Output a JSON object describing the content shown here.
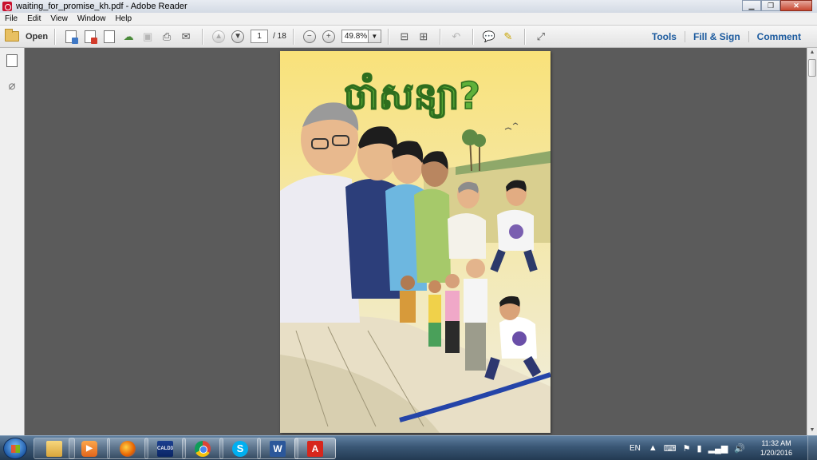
{
  "window": {
    "title": "waiting_for_promise_kh.pdf - Adobe Reader",
    "minimize": "▁",
    "restore": "❐",
    "close": "✕"
  },
  "menu": [
    "File",
    "Edit",
    "View",
    "Window",
    "Help"
  ],
  "toolbar": {
    "open_label": "Open",
    "page_current": "1",
    "page_total": "/ 18",
    "zoom_value": "49.8%",
    "zoom_dropdown": "▼",
    "tools_label": "Tools",
    "fill_sign_label": "Fill & Sign",
    "comment_label": "Comment"
  },
  "document": {
    "cover_title": "ចាំសន្យា?",
    "page_color": "#ffffff",
    "sky_color": "#f7e38a"
  },
  "taskbar": {
    "apps": [
      {
        "name": "windows-explorer",
        "glyph": ""
      },
      {
        "name": "media-player",
        "glyph": "▶"
      },
      {
        "name": "firefox",
        "glyph": ""
      },
      {
        "name": "cald3",
        "glyph": "CALD3"
      },
      {
        "name": "chrome",
        "glyph": ""
      },
      {
        "name": "skype",
        "glyph": "S"
      },
      {
        "name": "word",
        "glyph": "W"
      },
      {
        "name": "adobe-reader",
        "glyph": "A"
      }
    ],
    "language": "EN",
    "time": "11:32 AM",
    "date": "1/20/2016"
  },
  "colors": {
    "accent_link": "#1b5a9e",
    "title_green": "#5fb13a"
  }
}
